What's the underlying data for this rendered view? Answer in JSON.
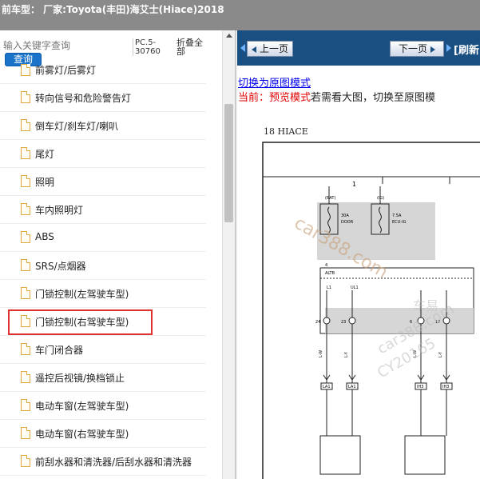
{
  "title_bar": {
    "text": "前车型： 厂家:Toyota(丰田)海艾士(Hiace)2018"
  },
  "search": {
    "placeholder": "输入关键字查询",
    "button_label": "查询"
  },
  "pc_code": "PC.5-30760",
  "collapse_all_label": "折叠全部",
  "tree": {
    "items": [
      {
        "label": "前雾灯/后雾灯"
      },
      {
        "label": "转向信号和危险警告灯"
      },
      {
        "label": "倒车灯/刹车灯/喇叭"
      },
      {
        "label": "尾灯"
      },
      {
        "label": "照明"
      },
      {
        "label": "车内照明灯"
      },
      {
        "label": "ABS"
      },
      {
        "label": "SRS/点烟器"
      },
      {
        "label": "门锁控制(左驾驶车型)"
      },
      {
        "label": "门锁控制(右驾驶车型)"
      },
      {
        "label": "车门闭合器"
      },
      {
        "label": "遥控后视镜/换档锁止"
      },
      {
        "label": "电动车窗(左驾驶车型)"
      },
      {
        "label": "电动车窗(右驾驶车型)"
      },
      {
        "label": "前刮水器和清洗器/后刮水器和清洗器"
      }
    ],
    "selected_index": 8
  },
  "nav": {
    "prev_label": "上一页",
    "next_label": "下一页",
    "refresh_label": "[刷新"
  },
  "preview": {
    "switch_link": "切换为原图模式",
    "current_prefix": "当前：",
    "current_mode": "预览模式",
    "hint": "若需看大图，切换至原图模"
  },
  "diagram": {
    "page_label": "18   HIACE",
    "column_number": "1",
    "fuse_bat": "(BAT)",
    "fuse_ig": "(IG)",
    "fuse1_rating": "30A",
    "fuse1_name": "DOOR",
    "fuse2_rating": "7.5A",
    "fuse2_name": "ECU-IG",
    "relay_pin": "4",
    "relay_name": "ALTB",
    "pin_l1": "L1",
    "pin_ul1": "UL1",
    "pins_bottom": [
      "24",
      "23",
      "6",
      "17"
    ],
    "connectors": [
      "LA1",
      "LA1",
      "IH3",
      "IH3"
    ],
    "wire_colors": [
      "L-W",
      "L-Y",
      "L-W",
      "L-Y"
    ],
    "watermark1": "car388.com",
    "watermark2": "car388.com",
    "watermark3": "CY20165",
    "watermark4": "车易"
  },
  "colors": {
    "nav_bg": "#1a4f82",
    "title_bg": "#8a8a8a",
    "search_button": "#1a73c9",
    "highlight": "#e03030"
  }
}
